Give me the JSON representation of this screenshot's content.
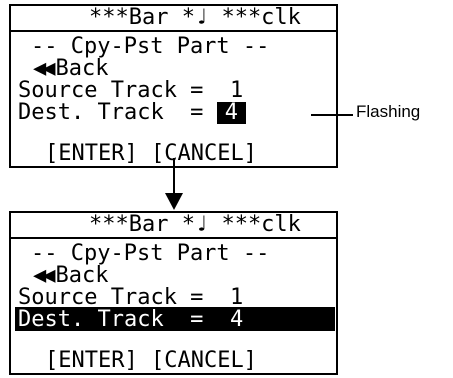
{
  "annotation": {
    "flashing_label": "Flashing"
  },
  "screen_before": {
    "header": "***Bar *♩ ***clk",
    "title": "-- Cpy-Pst Part --",
    "back_icon": "◀◀",
    "back_label": "Back",
    "source_track_label": "Source Track =",
    "source_track_value": "1",
    "dest_track_label": "Dest. Track  =",
    "dest_track_value": "4",
    "enter_label": "[ENTER]",
    "cancel_label": "[CANCEL]"
  },
  "screen_after": {
    "header": "***Bar *♩ ***clk",
    "title": "-- Cpy-Pst Part --",
    "back_icon": "◀◀",
    "back_label": "Back",
    "source_track_label": "Source Track =",
    "source_track_value": "1",
    "dest_track_label": "Dest. Track  =",
    "dest_track_value": "4",
    "enter_label": "[ENTER]",
    "cancel_label": "[CANCEL]"
  }
}
